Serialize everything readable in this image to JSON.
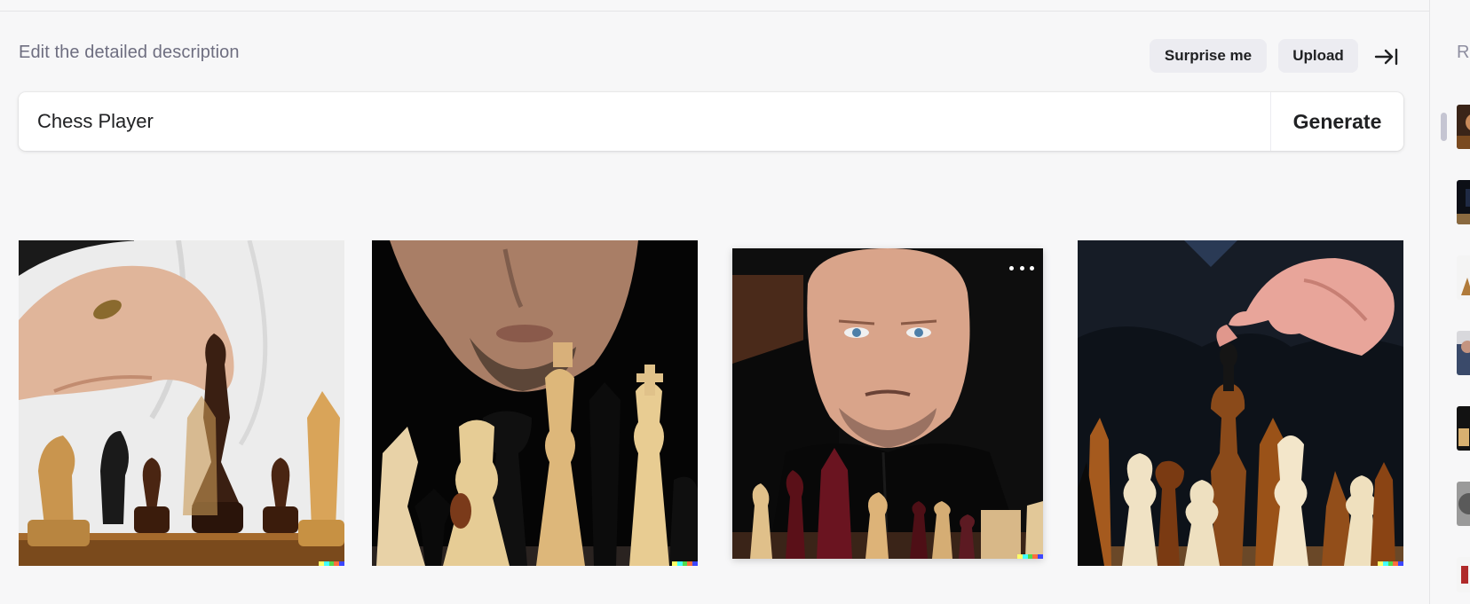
{
  "header": {
    "title": "Edit the detailed description",
    "surprise_label": "Surprise me",
    "upload_label": "Upload",
    "collapse_icon": "collapse-right-icon"
  },
  "prompt": {
    "value": "Chess Player",
    "generate_label": "Generate"
  },
  "results": [
    {
      "subject": "hand moving dark king on chessboard"
    },
    {
      "subject": "man's face behind black and white pieces"
    },
    {
      "subject": "bald man staring over chess pieces"
    },
    {
      "subject": "hand placing black pawn among pieces"
    }
  ],
  "more_icon": "more-horizontal-icon",
  "signature_colors": [
    "#ffff66",
    "#42ffff",
    "#51da4c",
    "#ff6e3c",
    "#3c46ff"
  ],
  "sidebar": {
    "title": "R",
    "thumb_count": 8
  }
}
